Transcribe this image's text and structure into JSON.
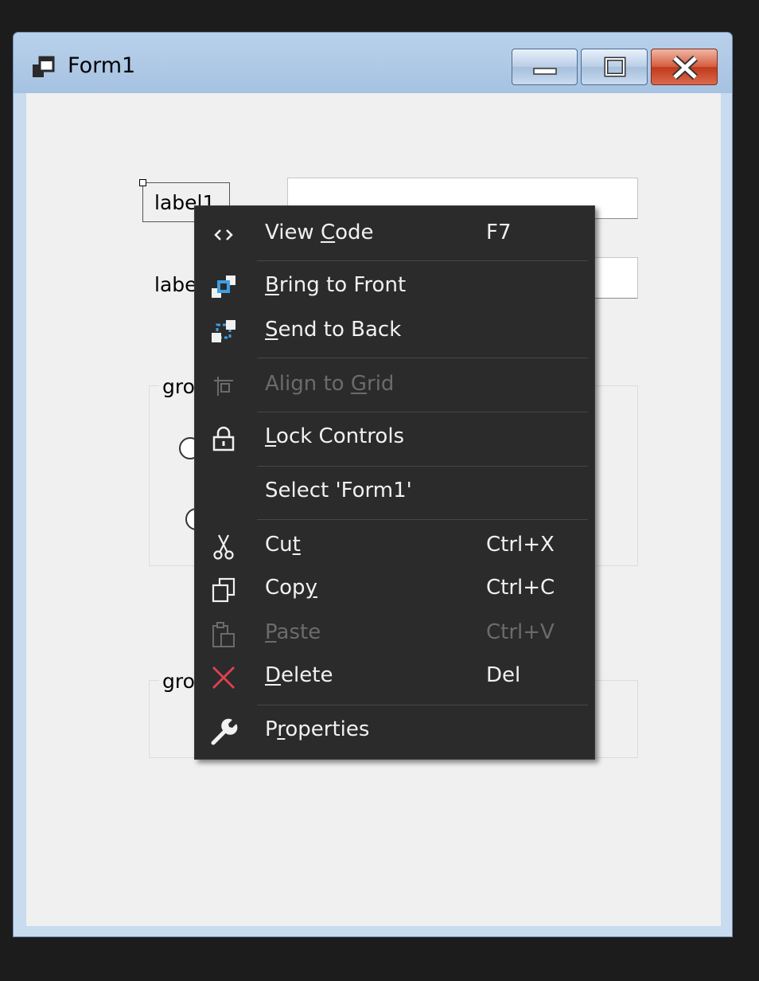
{
  "window": {
    "title": "Form1",
    "buttons": {
      "minimize": "minimize",
      "maximize": "maximize",
      "close": "close"
    }
  },
  "form": {
    "label1": "label1",
    "label2": "label2",
    "group1_caption": "groupBox1",
    "group2_caption": "groupBox2"
  },
  "context_menu": {
    "items": [
      {
        "pre": "View ",
        "key": "C",
        "post": "ode",
        "shortcut": "F7",
        "icon": "view-code-icon",
        "disabled": false
      },
      {
        "pre": "",
        "key": "B",
        "post": "ring to Front",
        "shortcut": "",
        "icon": "bring-to-front-icon",
        "disabled": false
      },
      {
        "pre": "",
        "key": "S",
        "post": "end to Back",
        "shortcut": "",
        "icon": "send-to-back-icon",
        "disabled": false
      },
      {
        "pre": "Align to ",
        "key": "G",
        "post": "rid",
        "shortcut": "",
        "icon": "align-to-grid-icon",
        "disabled": true
      },
      {
        "pre": "",
        "key": "L",
        "post": "ock Controls",
        "shortcut": "",
        "icon": "lock-icon",
        "disabled": false
      },
      {
        "pre": "Select 'Form1'",
        "key": "",
        "post": "",
        "shortcut": "",
        "icon": "",
        "disabled": false
      },
      {
        "pre": "Cu",
        "key": "t",
        "post": "",
        "shortcut": "Ctrl+X",
        "icon": "scissors-icon",
        "disabled": false
      },
      {
        "pre": "Cop",
        "key": "y",
        "post": "",
        "shortcut": "Ctrl+C",
        "icon": "copy-icon",
        "disabled": false
      },
      {
        "pre": "",
        "key": "P",
        "post": "aste",
        "shortcut": "Ctrl+V",
        "icon": "paste-icon",
        "disabled": true
      },
      {
        "pre": "",
        "key": "D",
        "post": "elete",
        "shortcut": "Del",
        "icon": "delete-x-icon",
        "disabled": false
      },
      {
        "pre": "P",
        "key": "r",
        "post": "operties",
        "shortcut": "",
        "icon": "wrench-icon",
        "disabled": false
      }
    ]
  },
  "colors": {
    "menu_bg": "#2b2b2b",
    "menu_text": "#f1f1f1",
    "menu_disabled": "#6b6b6b",
    "delete_red": "#e0414f",
    "accent_blue": "#3e9fe3"
  }
}
